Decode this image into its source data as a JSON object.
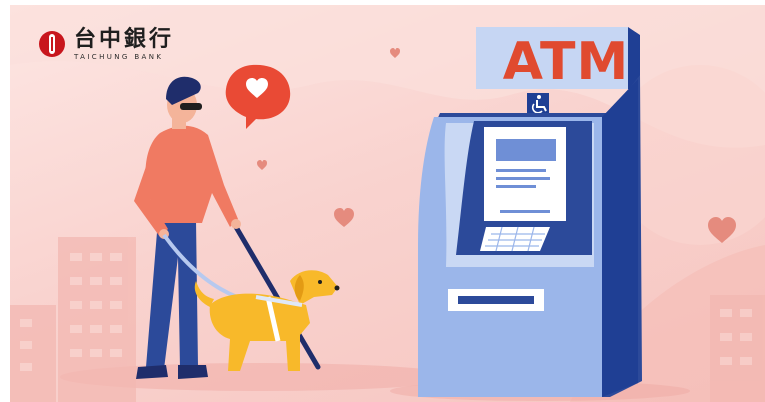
{
  "brand": {
    "name_cn": "台中銀行",
    "name_en": "TAICHUNG BANK",
    "color": "#c8161d"
  },
  "atm": {
    "label": "ATM",
    "accessibility_icon": "wheelchair-icon",
    "label_color": "#e04a2f",
    "body_color": "#2c4a9a"
  },
  "scene": {
    "subject": "visually-impaired-person-with-guide-dog",
    "decor_icons": [
      "heart-speech-bubble-icon",
      "heart-icon"
    ]
  }
}
